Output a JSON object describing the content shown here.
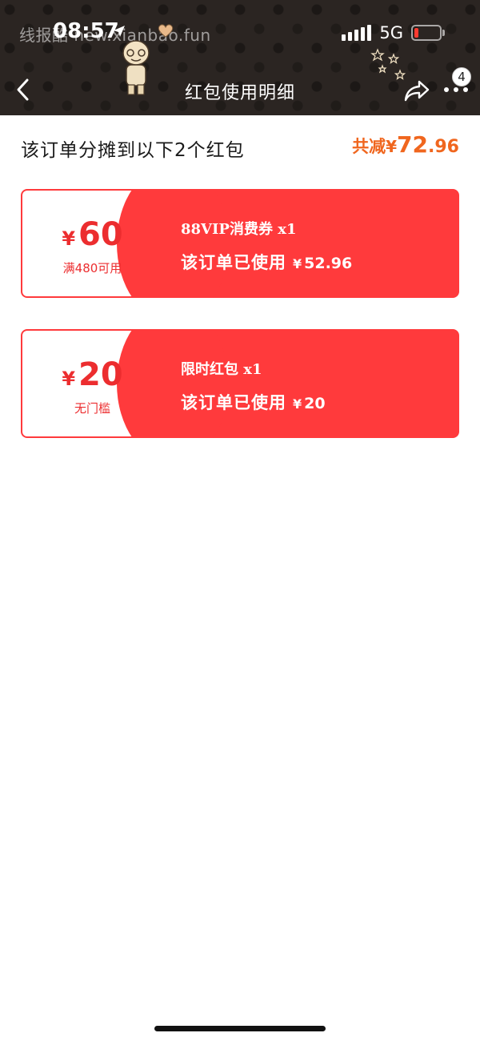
{
  "status_bar": {
    "watermark": "线报酷 new.xianbao.fun",
    "time": "08:57",
    "network": "5G"
  },
  "nav": {
    "title": "红包使用明细",
    "more_badge": "4"
  },
  "summary": {
    "text": "该订单分摊到以下2个红包",
    "total_label": "共减",
    "total_currency": "¥",
    "total_int": "72",
    "total_dec": ".96"
  },
  "coupons": [
    {
      "currency": "¥",
      "amount": "60",
      "condition": "满480可用",
      "name": "88VIP消费券 x1",
      "used_label": "该订单已使用",
      "used_currency": "¥",
      "used_value": "52.96"
    },
    {
      "currency": "¥",
      "amount": "20",
      "condition": "无门槛",
      "name": "限时红包 x1",
      "used_label": "该订单已使用",
      "used_currency": "¥",
      "used_value": "20"
    }
  ],
  "colors": {
    "header_bg": "#2b2522",
    "coupon_red": "#ff3a3c",
    "total_orange": "#f0661e"
  },
  "icons": [
    "back-arrow-icon",
    "share-icon",
    "more-icon",
    "location-arrow-icon",
    "heart-icon",
    "signal-icon",
    "battery-icon"
  ]
}
